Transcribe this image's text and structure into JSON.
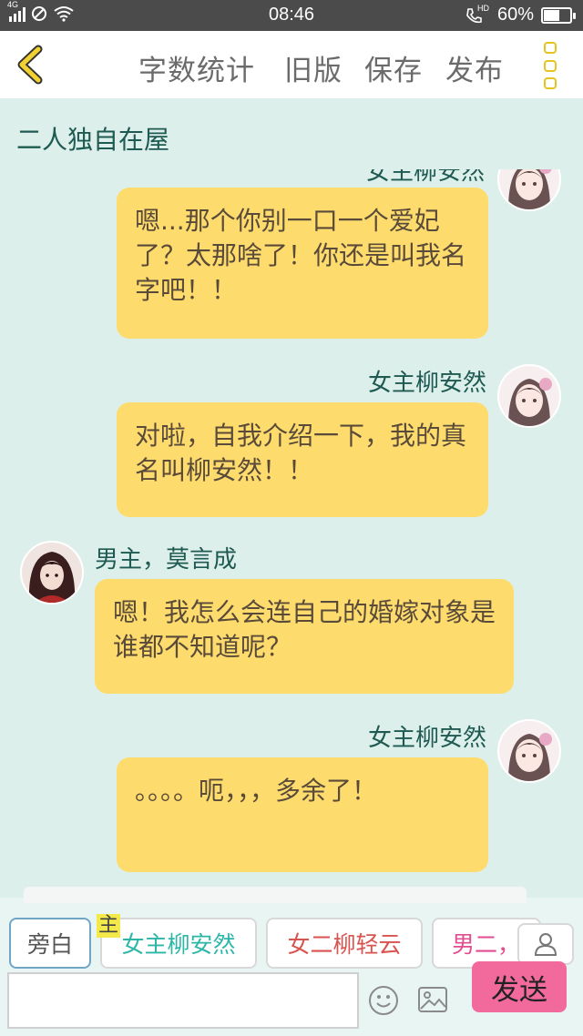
{
  "status_bar": {
    "network": "4G",
    "time": "08:46",
    "hd": "HD",
    "battery": "60%",
    "battery_level": 0.6
  },
  "toolbar": {
    "back_icon": "chevron-left-icon",
    "word_count": "字数统计",
    "old_version": "旧版",
    "save": "保存",
    "publish": "发布",
    "more_icon": "more-vertical-icon"
  },
  "story": {
    "title": "二人独自在屋"
  },
  "messages": [
    {
      "speaker": "女主柳安然",
      "side": "right",
      "text": "嗯...那个你别一口一个爱妃了？太那啥了！你还是叫我名字吧！！"
    },
    {
      "speaker": "女主柳安然",
      "side": "right",
      "text": "对啦，自我介绍一下，我的真名叫柳安然！！"
    },
    {
      "speaker": "男主，莫言成",
      "side": "left",
      "text": "嗯！我怎么会连自己的婚嫁对象是谁都不知道呢？"
    },
    {
      "speaker": "女主柳安然",
      "side": "right",
      "text": "。。。。呃，，，多余了！"
    }
  ],
  "character_bar": {
    "narrator": "旁白",
    "female_lead": "女主柳安然",
    "second_female": "女二柳轻云",
    "second_male": "男二，",
    "highlight_char": "主",
    "add_character_icon": "person-icon"
  },
  "input": {
    "placeholder": "",
    "emoji_icon": "smiley-icon",
    "image_icon": "image-icon",
    "send": "发送"
  },
  "colors": {
    "background": "#dcefeb",
    "bubble": "#fddc6d",
    "accent_yellow": "#e6c420",
    "send_button": "#f26a9c",
    "speaker_text": "#1f5a52"
  }
}
